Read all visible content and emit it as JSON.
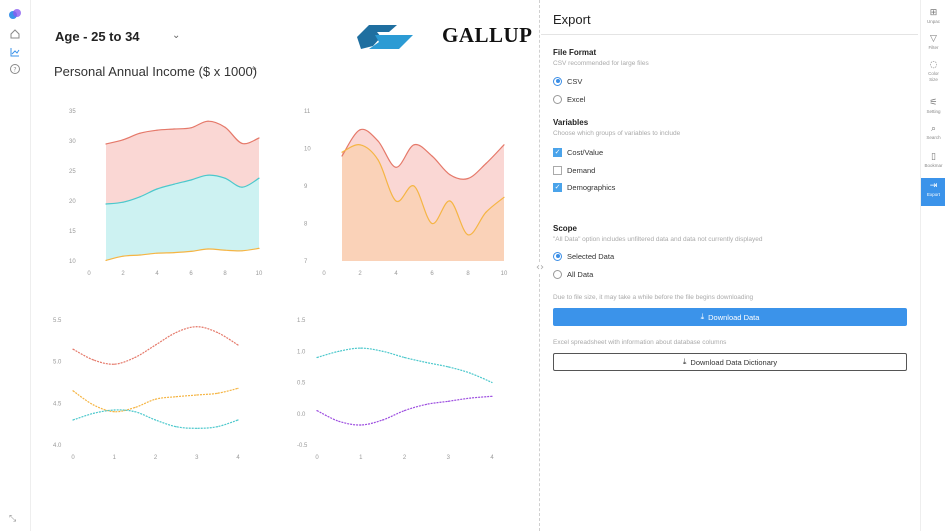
{
  "header": {
    "age_group": "Age - 25 to 34",
    "metric": "Personal Annual Income ($ x 1000)",
    "logo_text": "GALLUP"
  },
  "export": {
    "title": "Export",
    "file_format": {
      "title": "File Format",
      "subtitle": "CSV recommended for large files",
      "options": [
        {
          "label": "CSV",
          "selected": true
        },
        {
          "label": "Excel",
          "selected": false
        }
      ]
    },
    "variables": {
      "title": "Variables",
      "subtitle": "Choose which groups of variables to include",
      "options": [
        {
          "label": "Cost/Value",
          "checked": true
        },
        {
          "label": "Demand",
          "checked": false
        },
        {
          "label": "Demographics",
          "checked": true
        }
      ]
    },
    "scope": {
      "title": "Scope",
      "subtitle": "\"All Data\" option includes unfiltered data and data not currently displayed",
      "options": [
        {
          "label": "Selected Data",
          "selected": true
        },
        {
          "label": "All Data",
          "selected": false
        }
      ]
    },
    "download_note": "Due to file size, it may take a while before the file begins downloading",
    "download_button": "Download Data",
    "dictionary_note": "Excel spreadsheet with information about database columns",
    "dictionary_button": "Download Data Dictionary"
  },
  "right_rail": {
    "items": [
      {
        "label": "Unpac",
        "icon": "package-icon"
      },
      {
        "label": "Filter",
        "icon": "filter-icon"
      },
      {
        "label": "Color",
        "label2": "Size",
        "icon": "palette-icon"
      },
      {
        "label": "Setting",
        "icon": "sliders-icon"
      },
      {
        "label": "Search",
        "icon": "search-icon"
      },
      {
        "label": "Bookmar",
        "icon": "bookmark-icon"
      },
      {
        "label": "Export",
        "icon": "export-icon",
        "active": true
      }
    ]
  },
  "left_rail": {
    "icons": [
      "app-logo-icon",
      "home-icon",
      "chart-icon",
      "help-icon",
      "collapse-icon"
    ]
  },
  "colors": {
    "accent": "#3b93ea",
    "red_series": "#e5796a",
    "red_fill": "#f9d3cf",
    "teal_series": "#4cc8cc",
    "teal_fill": "#c8f1f1",
    "orange_series": "#f5b544",
    "orange_fill": "#f9cdb0",
    "purple_series": "#9d4ee0"
  },
  "chart_data": [
    {
      "type": "area",
      "xlim": [
        0,
        10
      ],
      "ylim": [
        10,
        35
      ],
      "x_ticks": [
        "0",
        "2",
        "4",
        "6",
        "8",
        "10"
      ],
      "y_ticks": [
        "10",
        "15",
        "20",
        "25",
        "30",
        "35"
      ],
      "grid": false,
      "series": [
        {
          "color": "red",
          "x": [
            1,
            2,
            3,
            4,
            5,
            6,
            7,
            8,
            9,
            10
          ],
          "values": [
            29.5,
            30.2,
            31.3,
            31.8,
            32.0,
            32.2,
            33.3,
            32.3,
            29.6,
            30.5
          ]
        },
        {
          "color": "teal",
          "x": [
            1,
            2,
            3,
            4,
            5,
            6,
            7,
            8,
            9,
            10
          ],
          "values": [
            19.5,
            19.8,
            20.7,
            22.0,
            22.8,
            23.5,
            24.3,
            23.8,
            22.3,
            23.8
          ]
        },
        {
          "color": "orange",
          "x": [
            1,
            2,
            3,
            4,
            5,
            6,
            7,
            8,
            9,
            10
          ],
          "values": [
            10.1,
            10.8,
            11.0,
            11.3,
            11.4,
            11.6,
            12.0,
            11.8,
            11.7,
            12.1
          ]
        }
      ]
    },
    {
      "type": "area",
      "xlim": [
        0,
        10
      ],
      "ylim": [
        7,
        11
      ],
      "x_ticks": [
        "0",
        "2",
        "4",
        "6",
        "8",
        "10"
      ],
      "y_ticks": [
        "7",
        "8",
        "9",
        "10",
        "11"
      ],
      "grid": false,
      "series": [
        {
          "color": "red",
          "x": [
            1,
            2,
            3,
            4,
            5,
            6,
            7,
            8,
            9,
            10
          ],
          "values": [
            9.8,
            10.5,
            10.2,
            9.5,
            10.1,
            9.8,
            9.3,
            9.2,
            9.6,
            10.1
          ]
        },
        {
          "color": "orange",
          "x": [
            1,
            2,
            3,
            4,
            5,
            6,
            7,
            8,
            9,
            10
          ],
          "values": [
            9.9,
            10.1,
            9.7,
            8.6,
            9.0,
            8.0,
            8.6,
            7.7,
            8.3,
            8.7
          ]
        }
      ]
    },
    {
      "type": "line",
      "xlim": [
        0,
        4
      ],
      "ylim": [
        4.0,
        5.5
      ],
      "x_ticks": [
        "0",
        "1",
        "2",
        "3",
        "4"
      ],
      "y_ticks": [
        "4.0",
        "4.5",
        "5.0",
        "5.5"
      ],
      "grid": false,
      "series": [
        {
          "color": "red",
          "x": [
            0,
            0.5,
            1,
            1.5,
            2,
            2.5,
            3,
            3.5,
            4
          ],
          "values": [
            5.15,
            5.02,
            4.97,
            5.05,
            5.2,
            5.35,
            5.42,
            5.35,
            5.2
          ]
        },
        {
          "color": "orange",
          "x": [
            0,
            0.5,
            1,
            1.5,
            2,
            2.5,
            3,
            3.5,
            4
          ],
          "values": [
            4.65,
            4.48,
            4.4,
            4.45,
            4.55,
            4.58,
            4.6,
            4.62,
            4.68
          ]
        },
        {
          "color": "teal",
          "x": [
            0,
            0.5,
            1,
            1.5,
            2,
            2.5,
            3,
            3.5,
            4
          ],
          "values": [
            4.3,
            4.38,
            4.42,
            4.4,
            4.3,
            4.22,
            4.2,
            4.22,
            4.3
          ]
        }
      ]
    },
    {
      "type": "line",
      "xlim": [
        0,
        4
      ],
      "ylim": [
        -0.5,
        1.5
      ],
      "x_ticks": [
        "0",
        "1",
        "2",
        "3",
        "4"
      ],
      "y_ticks": [
        "-0.5",
        "0.0",
        "0.5",
        "1.0",
        "1.5"
      ],
      "grid": false,
      "series": [
        {
          "color": "teal",
          "x": [
            0,
            0.5,
            1,
            1.5,
            2,
            2.5,
            3,
            3.5,
            4
          ],
          "values": [
            0.9,
            1.0,
            1.05,
            1.0,
            0.9,
            0.82,
            0.75,
            0.65,
            0.5
          ]
        },
        {
          "color": "purple",
          "x": [
            0,
            0.5,
            1,
            1.5,
            2,
            2.5,
            3,
            3.5,
            4
          ],
          "values": [
            0.05,
            -0.12,
            -0.18,
            -0.1,
            0.05,
            0.15,
            0.2,
            0.25,
            0.28
          ]
        }
      ]
    }
  ]
}
